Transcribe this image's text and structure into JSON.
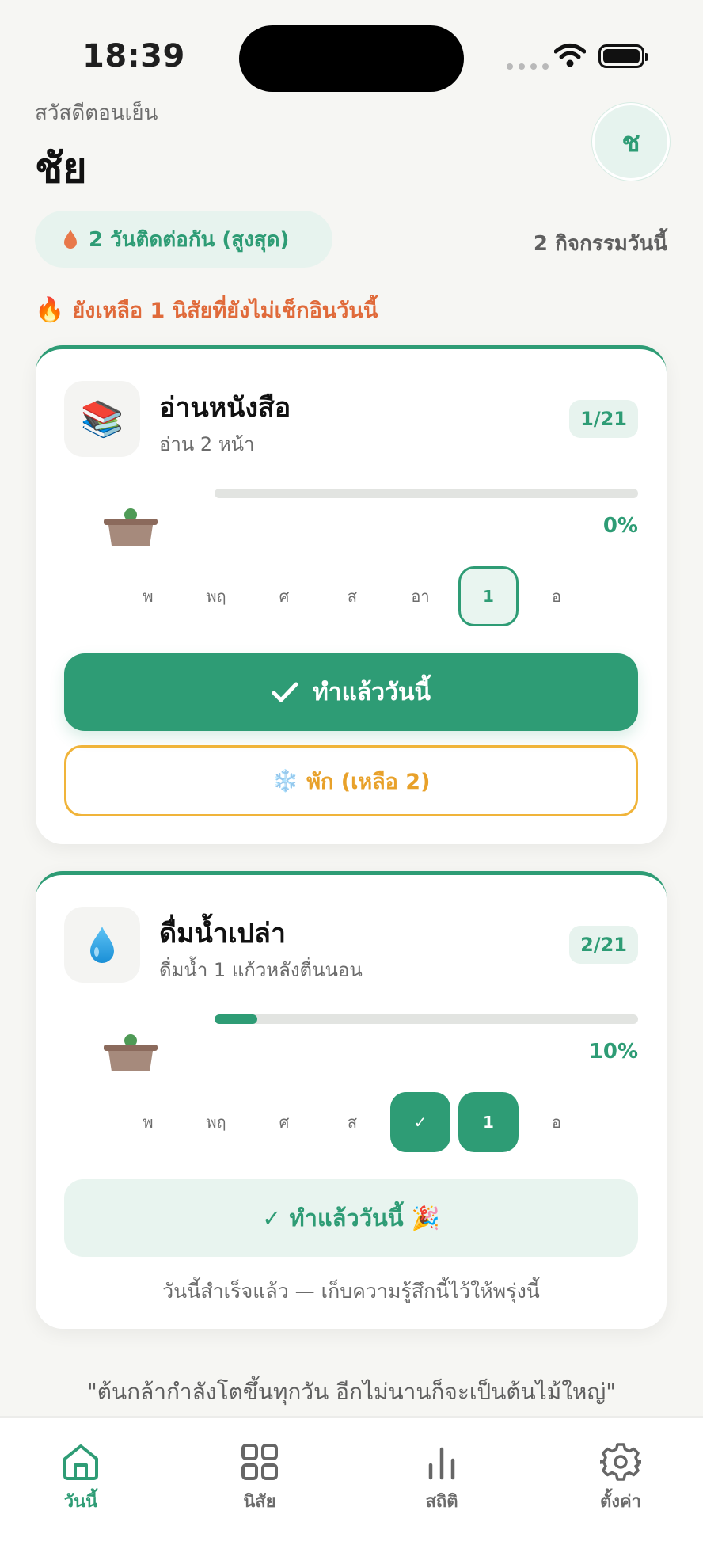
{
  "status_bar": {
    "time": "18:39"
  },
  "header": {
    "greeting": "สวัสดีตอนเย็น",
    "username": "ชัย",
    "avatar_initial": "ช"
  },
  "summary": {
    "streak": "2 วันติดต่อกัน (สูงสุด)",
    "today_count": "2 กิจกรรมวันนี้"
  },
  "reminder": {
    "icon": "fire-icon",
    "text": "ยังเหลือ 1 นิสัยที่ยังไม่เช็กอินวันนี้"
  },
  "habits": [
    {
      "icon": "books-icon",
      "title": "อ่านหนังสือ",
      "subtitle": "อ่าน 2 หน้า",
      "badge": "1/21",
      "progress_percent": 0,
      "percent_label": "0%",
      "days": [
        {
          "label": "พ",
          "state": "none"
        },
        {
          "label": "พฤ",
          "state": "none"
        },
        {
          "label": "ศ",
          "state": "none"
        },
        {
          "label": "ส",
          "state": "none"
        },
        {
          "label": "อา",
          "state": "none"
        },
        {
          "label": "1",
          "state": "today"
        },
        {
          "label": "อ",
          "state": "none"
        }
      ],
      "primary_button": "ทำแล้ววันนี้",
      "rest_button": "พัก (เหลือ 2)"
    },
    {
      "icon": "water-drop-icon",
      "title": "ดื่มน้ำเปล่า",
      "subtitle": "ดื่มน้ำ 1 แก้วหลังตื่นนอน",
      "badge": "2/21",
      "progress_percent": 10,
      "percent_label": "10%",
      "days": [
        {
          "label": "พ",
          "state": "none"
        },
        {
          "label": "พฤ",
          "state": "none"
        },
        {
          "label": "ศ",
          "state": "none"
        },
        {
          "label": "ส",
          "state": "none"
        },
        {
          "label": "✓",
          "state": "done"
        },
        {
          "label": "1",
          "state": "today-done"
        },
        {
          "label": "อ",
          "state": "none"
        }
      ],
      "done_label": "✓ ทำแล้ววันนี้ 🎉",
      "done_note": "วันนี้สำเร็จแล้ว — เก็บความรู้สึกนี้ไว้ให้พรุ่งนี้"
    }
  ],
  "quote": "\"ต้นกล้ากำลังโตขึ้นทุกวัน อีกไม่นานก็จะเป็นต้นไม้ใหญ่\"",
  "tabbar": {
    "tabs": [
      {
        "label": "วันนี้",
        "icon": "home-icon",
        "active": true
      },
      {
        "label": "นิสัย",
        "icon": "grid-icon",
        "active": false
      },
      {
        "label": "สถิติ",
        "icon": "bar-chart-icon",
        "active": false
      },
      {
        "label": "ตั้งค่า",
        "icon": "gear-icon",
        "active": false
      }
    ]
  },
  "colors": {
    "accent": "#2e9c75",
    "accent_light": "#e7f3ee",
    "warning": "#e06a3a",
    "rest": "#f0b43a"
  }
}
